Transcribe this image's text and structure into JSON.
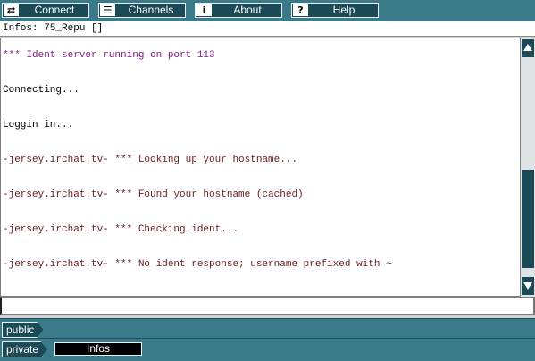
{
  "toolbar": {
    "buttons": [
      {
        "label": "Connect",
        "icon": "connect-arrows-icon"
      },
      {
        "label": "Channels",
        "icon": "channels-list-icon"
      },
      {
        "label": "About",
        "icon": "info-icon"
      },
      {
        "label": "Help",
        "icon": "question-icon"
      }
    ]
  },
  "info_line": "Infos: 75_Repu []",
  "chat": {
    "lines": [
      "*** Ident server running on port 113",
      "Connecting...",
      "Loggin in...",
      "-jersey.irchat.tv- *** Looking up your hostname...",
      "-jersey.irchat.tv- *** Found your hostname (cached)",
      "-jersey.irchat.tv- *** Checking ident...",
      "-jersey.irchat.tv- *** No ident response; username prefixed with ~"
    ]
  },
  "input": {
    "value": ""
  },
  "tabs": {
    "public_label": "public",
    "private_label": "private",
    "window_tabs": [
      "Infos"
    ]
  },
  "colors": {
    "toolbar_bg": "#3b7b89",
    "button_bg": "#1a4a56",
    "system_text": "#8a1c8a",
    "server_text": "#6a1a1a"
  }
}
